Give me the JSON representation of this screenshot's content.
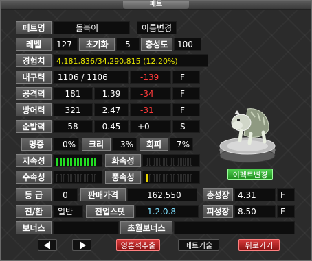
{
  "window": {
    "title": "페트"
  },
  "pet": {
    "name_label": "페트명",
    "name": "돌북이",
    "rename_button": "이름변경",
    "level_label": "레벨",
    "level": "127",
    "init_label": "초기화",
    "init": "5",
    "loyalty_label": "충성도",
    "loyalty": "100",
    "exp_label": "경험치",
    "exp": "4,181,836/34,290,815  (12.20%)"
  },
  "stats": [
    {
      "label": "내구력",
      "v1": "1106 / 1106",
      "v2": "",
      "mod": "-139",
      "grade": "F"
    },
    {
      "label": "공격력",
      "v1": "181",
      "v2": "1.39",
      "mod": "-34",
      "grade": "F"
    },
    {
      "label": "방어력",
      "v1": "321",
      "v2": "2.47",
      "mod": "-31",
      "grade": "F"
    },
    {
      "label": "순발력",
      "v1": "58",
      "v2": "0.45",
      "mod": "+0",
      "grade": "S"
    }
  ],
  "hit": {
    "label": "명중",
    "value": "0%"
  },
  "crit": {
    "label": "크리",
    "value": "3%"
  },
  "evade": {
    "label": "회피",
    "value": "7%"
  },
  "elements": {
    "earth_label": "지속성",
    "earth_value": 10,
    "fire_label": "화속성",
    "fire_value": 0,
    "water_label": "수속성",
    "water_value": 0,
    "wind_label": "풍속성",
    "wind_value": 1,
    "max": 10,
    "earth_color": "#22dd22",
    "wind_color": "#e6d200"
  },
  "info": {
    "grade_label": "등 급",
    "grade": "0",
    "price_label": "판매가격",
    "price": "162,550",
    "total_growth_label": "총성장",
    "total_growth": "4.31",
    "total_growth_grade": "F",
    "evo_label": "진/환",
    "evo": "일반",
    "skill_label": "전업스텟",
    "skill": "1.2.0.8",
    "hp_growth_label": "피성장",
    "hp_growth": "8.50",
    "hp_growth_grade": "F",
    "bonus_label": "보너스",
    "bonus": "",
    "super_bonus_label": "초월보너스",
    "super_bonus": ""
  },
  "buttons": {
    "effect_change": "이펙트변경",
    "soul_extract": "영혼석추출",
    "pet_skill": "페트기술",
    "back": "뒤로가기"
  }
}
